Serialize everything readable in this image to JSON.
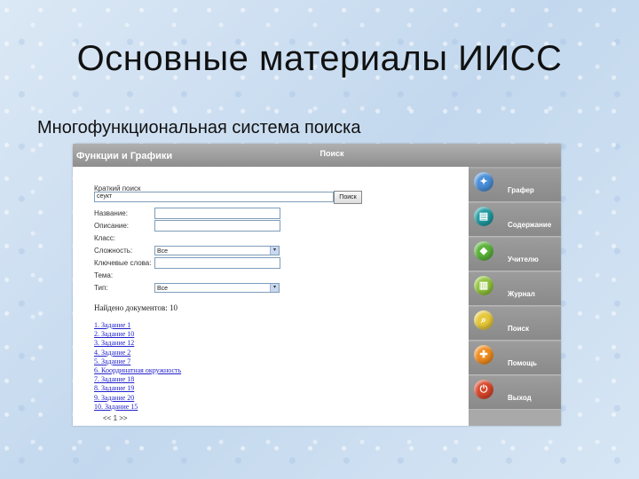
{
  "slide": {
    "title": "Основные материалы ИИСС",
    "subtitle": "Многофункциональная система поиска"
  },
  "app": {
    "title": "Функции и Графики",
    "header_tab": "Поиск",
    "search": {
      "label": "Краткий поиск",
      "value": "сеукт",
      "button": "Поиск"
    },
    "fields": [
      {
        "label": "Название:",
        "kind": "input",
        "value": ""
      },
      {
        "label": "Описание:",
        "kind": "input",
        "value": ""
      },
      {
        "label": "Класс:",
        "kind": "none",
        "value": ""
      },
      {
        "label": "Сложность:",
        "kind": "select",
        "value": "Все"
      },
      {
        "label": "Ключевые слова:",
        "kind": "input",
        "value": ""
      },
      {
        "label": "Тема:",
        "kind": "none",
        "value": ""
      },
      {
        "label": "Тип:",
        "kind": "select",
        "value": "Все"
      }
    ],
    "found_text": "Найдено документов: 10",
    "results": [
      "1. Задание 1",
      "2. Задание 10",
      "3. Задание 12",
      "4. Задание 2",
      "5. Задание 7",
      "6. Координатная окружность",
      "7. Задание 18",
      "8. Задание 19",
      "9. Задание 20",
      "10. Задание 15"
    ],
    "pager": "<< 1 >>",
    "nav": [
      {
        "label": "Графер",
        "icon": "graph-icon",
        "color": "#4a8fd8",
        "glyph": "✦"
      },
      {
        "label": "Содержание",
        "icon": "book-icon",
        "color": "#1f9aa0",
        "glyph": "▤"
      },
      {
        "label": "Учителю",
        "icon": "teacher-icon",
        "color": "#5bb33a",
        "glyph": "◆"
      },
      {
        "label": "Журнал",
        "icon": "journal-icon",
        "color": "#8fc23a",
        "glyph": "▥"
      },
      {
        "label": "Поиск",
        "icon": "search-icon",
        "color": "#e6c83a",
        "glyph": "⌕"
      },
      {
        "label": "Помощь",
        "icon": "help-icon",
        "color": "#f08c1e",
        "glyph": "✚"
      },
      {
        "label": "Выход",
        "icon": "exit-icon",
        "color": "#d9462a",
        "glyph": "⏻"
      }
    ]
  }
}
